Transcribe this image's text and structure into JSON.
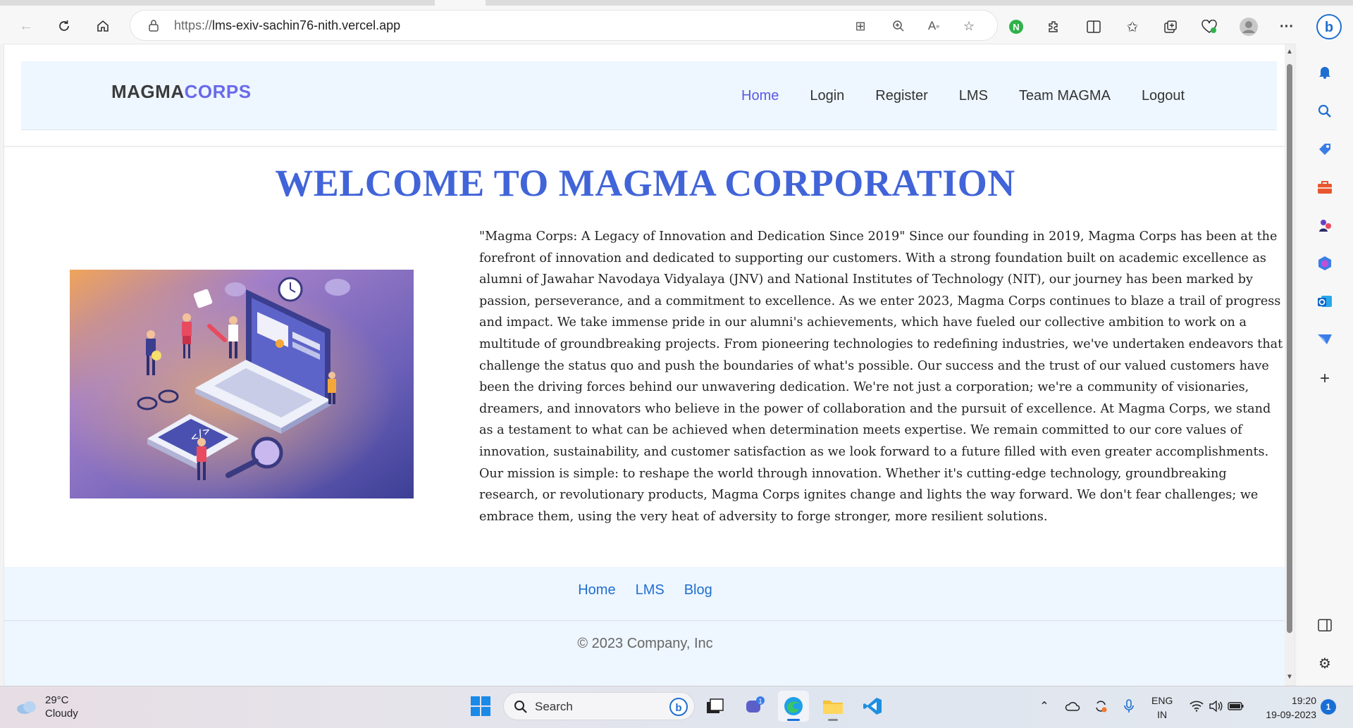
{
  "browser": {
    "url_prefix": "https://",
    "url_host": "lms-exiv-sachin76-nith.vercel.app"
  },
  "site": {
    "brand_main": "MAGMA",
    "brand_accent": "CORPS",
    "nav": [
      {
        "label": "Home",
        "active": true
      },
      {
        "label": "Login"
      },
      {
        "label": "Register"
      },
      {
        "label": "LMS"
      },
      {
        "label": "Team MAGMA"
      },
      {
        "label": "Logout"
      }
    ],
    "welcome_title": "WELCOME TO MAGMA CORPORATION",
    "about_paragraph_1": "\"Magma Corps: A Legacy of Innovation and Dedication Since 2019\" Since our founding in 2019, Magma Corps has been at the forefront of innovation and dedicated to supporting our customers. With a strong foundation built on academic excellence as alumni of Jawahar Navodaya Vidyalaya (JNV) and National Institutes of Technology (NIT), our journey has been marked by passion, perseverance, and a commitment to excellence. As we enter 2023, Magma Corps continues to blaze a trail of progress and impact. We take immense pride in our alumni's achievements, which have fueled our collective ambition to work on a multitude of groundbreaking projects. From pioneering technologies to redefining industries, we've undertaken endeavors that challenge the status quo and push the boundaries of what's possible. Our success and the trust of our valued customers have been the driving forces behind our unwavering dedication. We're not just a corporation; we're a community of visionaries, dreamers, and innovators who believe in the power of collaboration and the pursuit of excellence. At Magma Corps, we stand as a testament to what can be achieved when determination meets expertise. We remain committed to our core values of innovation, sustainability, and customer satisfaction as we look forward to a future filled with even greater accomplishments.",
    "about_paragraph_2": "Our mission is simple: to reshape the world through innovation. Whether it's cutting-edge technology, groundbreaking research, or revolutionary products, Magma Corps ignites change and lights the way forward. We don't fear challenges; we embrace them, using the very heat of adversity to forge stronger, more resilient solutions.",
    "footer_links": [
      "Home",
      "LMS",
      "Blog"
    ],
    "copyright": "© 2023 Company, Inc"
  },
  "taskbar": {
    "weather_temp": "29°C",
    "weather_desc": "Cloudy",
    "search_label": "Search",
    "chat_badge": "1",
    "lang_line1": "ENG",
    "lang_line2": "IN",
    "time": "19:20",
    "date": "19-09-2023",
    "notification_count": "1"
  },
  "colors": {
    "brand_accent": "#6a6aea",
    "welcome_title": "#4164d8",
    "nav_active": "#5a5ae0",
    "footer_link": "#1f6fd0",
    "header_bg": "#eef6ff"
  }
}
